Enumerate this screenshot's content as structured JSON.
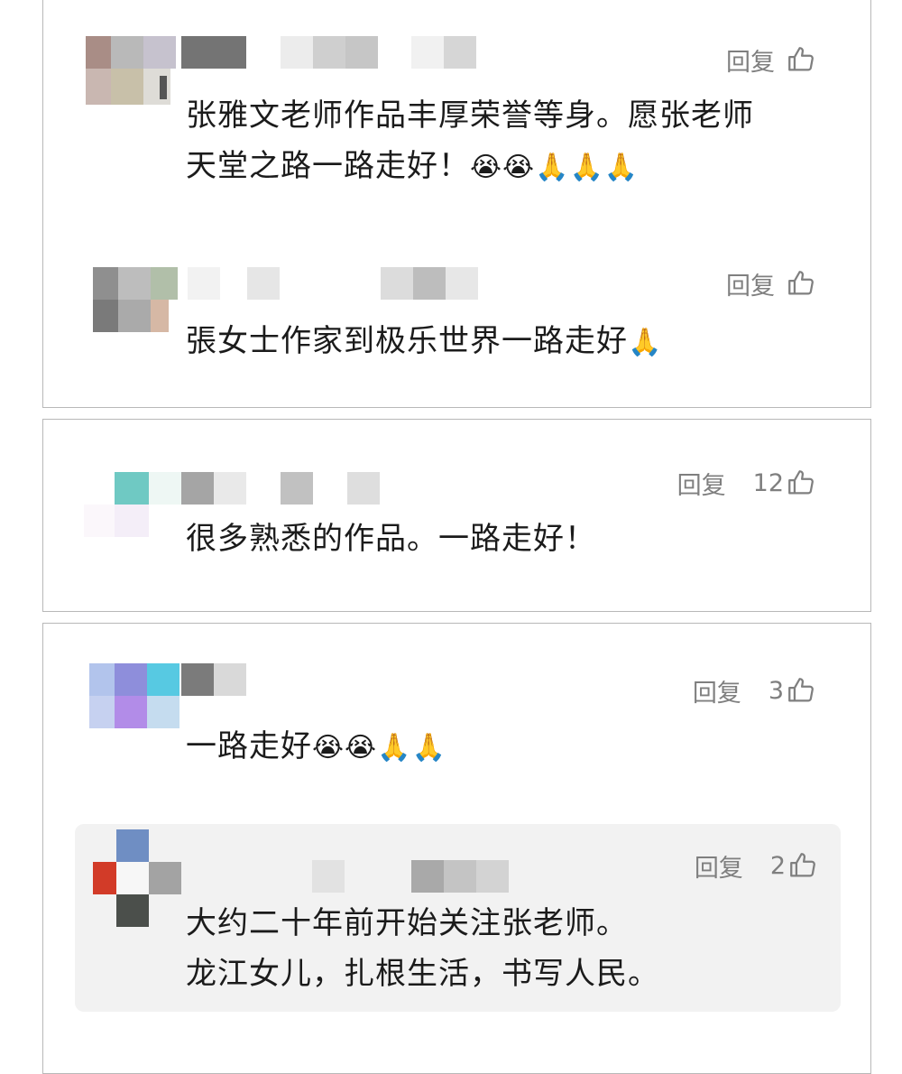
{
  "comments": [
    {
      "reply_label": "回复",
      "likes": "",
      "lines": [
        "张雅文老师作品丰厚荣誉等身。愿张老师",
        "天堂之路一路走好！"
      ],
      "emoji": "😭😭🙏🙏🙏"
    },
    {
      "reply_label": "回复",
      "likes": "",
      "lines": [
        "張女士作家到极乐世界一路走好"
      ],
      "emoji": "🙏"
    },
    {
      "reply_label": "回复",
      "likes": "12",
      "lines": [
        "很多熟悉的作品。一路走好！"
      ],
      "emoji": ""
    },
    {
      "reply_label": "回复",
      "likes": "3",
      "lines": [
        "一路走好"
      ],
      "emoji": "😭😭🙏🙏"
    },
    {
      "reply_label": "回复",
      "likes": "2",
      "lines": [
        "大约二十年前开始关注张老师。",
        "龙江女儿，扎根生活，书写人民。"
      ],
      "emoji": ""
    }
  ],
  "icons": {
    "like": "thumbs-up-icon",
    "avatar": "blurred-avatar",
    "nickname": "blurred-nickname"
  },
  "colors": {
    "meta_text": "#7f7f7f",
    "body_text": "#1b1b1b",
    "card_border": "#b8b8b8",
    "reply_bg": "#f2f2f2"
  }
}
